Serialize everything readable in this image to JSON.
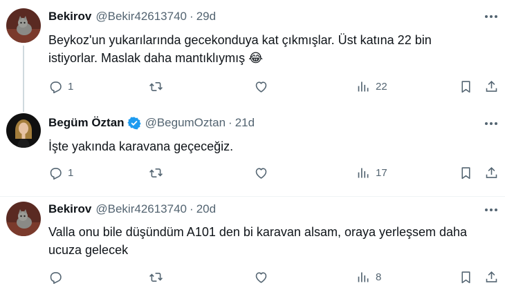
{
  "tweets": [
    {
      "name": "Bekirov",
      "handle": "@Bekir42613740",
      "time": "29d",
      "text_lines": [
        "Beykoz'un yukarılarında gecekonduya kat çıkmışlar. Üst katına 22 bin",
        "istiyorlar. Maslak daha mantıklıymış 😂"
      ],
      "replies": "1",
      "reposts": "",
      "likes": "",
      "views": "22",
      "verified": false
    },
    {
      "name": "Begüm Öztan",
      "handle": "@BegumOztan",
      "time": "21d",
      "text_lines": [
        "İşte yakında karavana geçeceğiz."
      ],
      "replies": "1",
      "reposts": "",
      "likes": "",
      "views": "17",
      "verified": true
    },
    {
      "name": "Bekirov",
      "handle": "@Bekir42613740",
      "time": "20d",
      "text_lines": [
        "Valla onu bile düşündüm A101 den bi karavan alsam, oraya yerleşsem daha",
        "ucuza gelecek"
      ],
      "replies": "",
      "reposts": "",
      "likes": "",
      "views": "8",
      "verified": false
    }
  ],
  "colors": {
    "text": "#0f1419",
    "secondary": "#536471",
    "verified_blue": "#1d9bf0",
    "thread_line": "#cfd9de"
  },
  "icons": [
    "more-icon",
    "reply-icon",
    "repost-icon",
    "like-icon",
    "views-icon",
    "bookmark-icon",
    "share-icon",
    "verified-icon"
  ]
}
